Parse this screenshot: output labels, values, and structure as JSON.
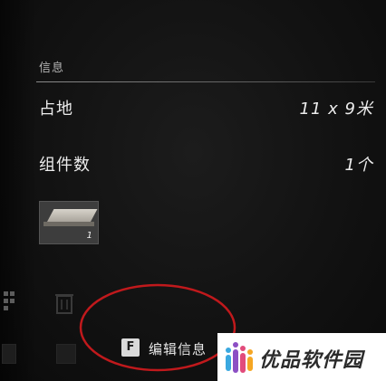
{
  "info_panel": {
    "section_title": "信息",
    "rows": [
      {
        "label": "占地",
        "value": "11 x 9米"
      },
      {
        "label": "组件数",
        "value": "1个"
      }
    ]
  },
  "component_item": {
    "icon": "wood-plank-icon",
    "count": "1"
  },
  "bottom_bar": {
    "edit_key": "F",
    "edit_label": "编辑信息"
  },
  "watermark": {
    "text": "优品软件园"
  },
  "colors": {
    "background": "#121212",
    "text": "#ececec",
    "annotation": "#c0191c",
    "key_badge": "#d9d9d9"
  }
}
